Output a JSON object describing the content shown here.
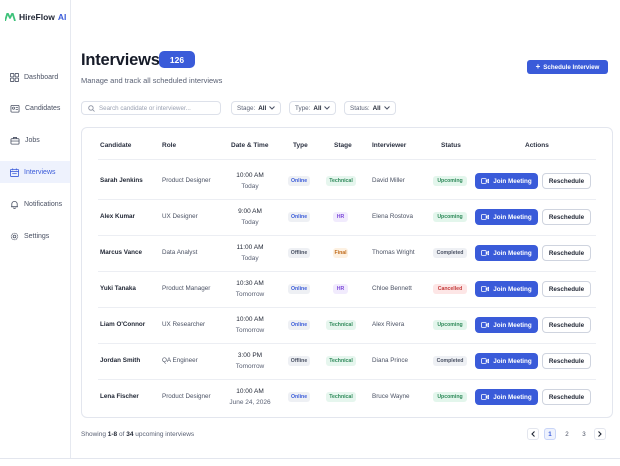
{
  "brand": {
    "name": "HireFlow",
    "suffix": "AI",
    "color": "#3a5bd9"
  },
  "sidebar": {
    "items": [
      {
        "label": "Dashboard",
        "icon": "dashboard-icon",
        "active": false
      },
      {
        "label": "Candidates",
        "icon": "users-icon",
        "active": false
      },
      {
        "label": "Jobs",
        "icon": "briefcase-icon",
        "active": false
      },
      {
        "label": "Interviews",
        "icon": "calendar-icon",
        "active": true
      },
      {
        "label": "Notifications",
        "icon": "bell-icon",
        "active": false
      },
      {
        "label": "Settings",
        "icon": "gear-icon",
        "active": false
      }
    ]
  },
  "header": {
    "title": "Interviews",
    "count": "126",
    "subtitle": "Manage and track all scheduled interviews",
    "schedule_label": "Schedule Interview"
  },
  "filters": {
    "search_placeholder": "Search candidate or interviewer...",
    "stage": {
      "label": "Stage:",
      "value": "All"
    },
    "type": {
      "label": "Type:",
      "value": "All"
    },
    "status": {
      "label": "Status:",
      "value": "All"
    }
  },
  "table": {
    "headers": [
      "Candidate",
      "Role",
      "Date & Time",
      "Type",
      "Stage",
      "Interviewer",
      "Status",
      "Actions"
    ],
    "join_label": "Join Meeting",
    "reschedule_label": "Reschedule",
    "rows": [
      {
        "candidate": "Sarah Jenkins",
        "role": "Product Designer",
        "time": "10:00 AM",
        "day": "Today",
        "type": "Online",
        "stage": "Technical",
        "interviewer": "David Miller",
        "status": "Upcoming"
      },
      {
        "candidate": "Alex Kumar",
        "role": "UX Designer",
        "time": "9:00 AM",
        "day": "Today",
        "type": "Online",
        "stage": "HR",
        "interviewer": "Elena Rostova",
        "status": "Upcoming"
      },
      {
        "candidate": "Marcus Vance",
        "role": "Data Analyst",
        "time": "11:00 AM",
        "day": "Today",
        "type": "Offline",
        "stage": "Final",
        "interviewer": "Thomas Wright",
        "status": "Completed"
      },
      {
        "candidate": "Yuki Tanaka",
        "role": "Product Manager",
        "time": "10:30 AM",
        "day": "Tomorrow",
        "type": "Online",
        "stage": "HR",
        "interviewer": "Chloe Bennett",
        "status": "Cancelled"
      },
      {
        "candidate": "Liam O'Connor",
        "role": "UX Researcher",
        "time": "10:00 AM",
        "day": "Tomorrow",
        "type": "Online",
        "stage": "Technical",
        "interviewer": "Alex Rivera",
        "status": "Upcoming"
      },
      {
        "candidate": "Jordan Smith",
        "role": "QA Engineer",
        "time": "3:00 PM",
        "day": "Tomorrow",
        "type": "Offline",
        "stage": "Technical",
        "interviewer": "Diana Prince",
        "status": "Completed"
      },
      {
        "candidate": "Lena Fischer",
        "role": "Product Designer",
        "time": "10:00 AM",
        "day": "June 24, 2026",
        "type": "Online",
        "stage": "Technical",
        "interviewer": "Bruce Wayne",
        "status": "Upcoming"
      }
    ]
  },
  "footer": {
    "prefix": "Showing",
    "range": "1-8",
    "of": "of",
    "total": "34",
    "suffix": "upcoming interviews",
    "pages": [
      "1",
      "2",
      "3"
    ],
    "current_page": "1"
  }
}
